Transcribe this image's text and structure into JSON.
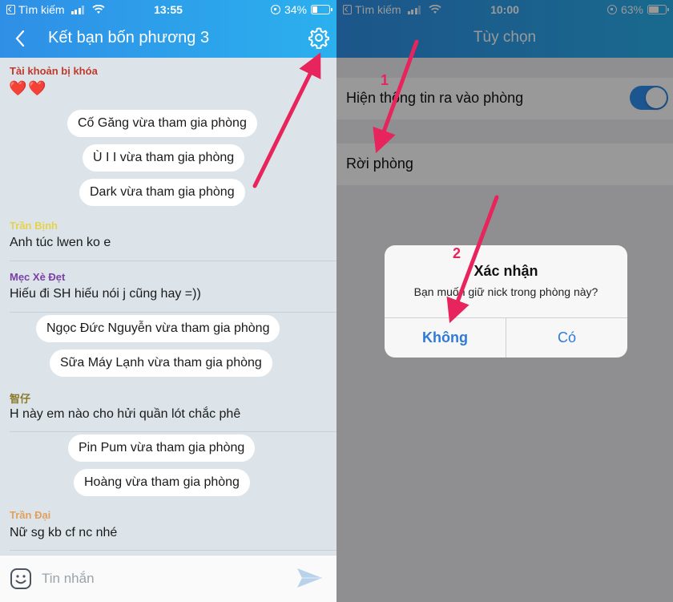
{
  "left": {
    "status": {
      "carrier": "Tìm kiếm",
      "time": "13:55",
      "battery": "34%",
      "battery_level": 0.34
    },
    "header": {
      "title": "Kết bạn bốn phương 3"
    },
    "messages": [
      {
        "name": "Tài khoản bị khóa",
        "color": "#c0392b",
        "text": "❤️❤️"
      },
      {
        "name": "Trần Bịnh",
        "color": "#e6d24a",
        "text": "Anh túc lwen ko e"
      },
      {
        "name": "Mẹc Xè Đẹt",
        "color": "#7b3fa6",
        "text": "Hiếu đi SH hiếu nói j cũng hay =))"
      },
      {
        "name": "智仔",
        "color": "#8a7a2a",
        "text": "H này em nào cho hửi quần lót chắc phê"
      },
      {
        "name": "Trần Đại",
        "color": "#e0a060",
        "text": "Nữ sg kb cf nc nhé"
      }
    ],
    "joins": [
      "Cố Găng vừa tham gia phòng",
      "Ù I I vừa tham gia phòng",
      "Dark vừa tham gia phòng",
      "Ngọc Đức Nguyễn vừa tham gia phòng",
      "Sữa Máy Lạnh vừa tham gia phòng",
      "Pin Pum vừa tham gia phòng",
      "Hoàng vừa tham gia phòng"
    ],
    "input": {
      "placeholder": "Tin nhắn"
    }
  },
  "right": {
    "status": {
      "carrier": "Tìm kiếm",
      "time": "10:00",
      "battery": "63%",
      "battery_level": 0.63
    },
    "header": {
      "title": "Tùy chọn"
    },
    "settings": [
      {
        "label": "Hiện thông tin ra vào phòng",
        "toggle_on": true
      },
      {
        "label": "Rời phòng"
      }
    ],
    "dialog": {
      "title": "Xác nhận",
      "message": "Bạn muốn giữ nick trong phòng này?",
      "no_label": "Không",
      "yes_label": "Có"
    },
    "annotations": {
      "step1": "1",
      "step2": "2"
    }
  },
  "colors": {
    "header": "#2f8fe6",
    "chat_bg": "#dce4e9",
    "accent_arrow": "#e8245c",
    "toggle": "#2f8ff0"
  }
}
